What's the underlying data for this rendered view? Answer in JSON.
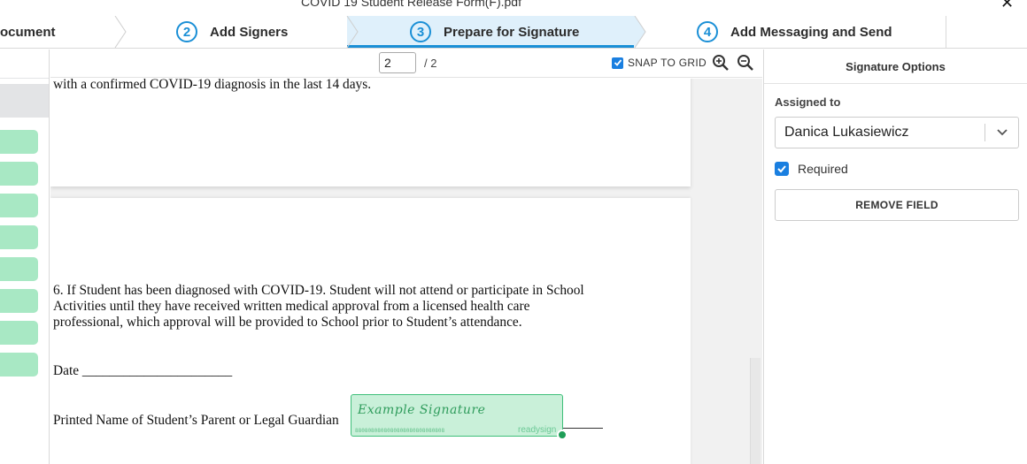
{
  "window": {
    "title": "COVID 19 Student Release Form(F).pdf",
    "close_glyph": "✕"
  },
  "steps": [
    {
      "label": "ocument"
    },
    {
      "number": "2",
      "label": "Add Signers"
    },
    {
      "number": "3",
      "label": "Prepare for Signature",
      "active": true
    },
    {
      "number": "4",
      "label": "Add Messaging and Send"
    }
  ],
  "toolbar": {
    "page_current": "2",
    "page_total": "/ 2",
    "snap_label": "SNAP TO GRID",
    "snap_checked": true,
    "zoom_in_icon": "zoom-in-icon",
    "zoom_out_icon": "zoom-out-icon"
  },
  "document": {
    "page1_line": "with a confirmed COVID-19 diagnosis in the last 14 days.",
    "para6": [
      "6. If Student has been diagnosed with COVID-19. Student will not attend or participate in School",
      "Activities until they have received written medical approval from a licensed health care",
      "professional, which approval will be provided to School prior to Student’s attendance."
    ],
    "date_line": "Date ______________________",
    "printed_name": "Printed Name of Student’s Parent or Legal Guardian"
  },
  "signature_field": {
    "placeholder": "Example Signature",
    "id_text": "8808080808080808080808080808",
    "brand": "readysign"
  },
  "right_panel": {
    "header": "Signature Options",
    "assigned_label": "Assigned to",
    "assigned_value": "Danica Lukasiewicz",
    "required_label": "Required",
    "required_checked": true,
    "remove_label": "REMOVE FIELD"
  },
  "colors": {
    "accent": "#1a8fd6",
    "active_step_bg": "#dff0fb",
    "signature_fill": "#c9f0d9",
    "signature_border": "#3fbf7a",
    "thumb_green": "#a8e8c4"
  }
}
